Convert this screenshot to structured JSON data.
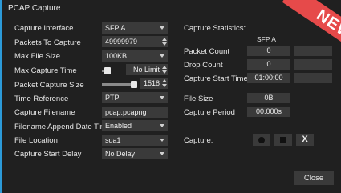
{
  "window": {
    "title": "PCAP Capture"
  },
  "settings": {
    "rows": [
      {
        "label": "Capture Interface",
        "value": "SFP A"
      },
      {
        "label": "Packets To Capture",
        "value": "49999979"
      },
      {
        "label": "Max File Size",
        "value": "100KB"
      },
      {
        "label": "Max Capture Time",
        "value": "No Limit"
      },
      {
        "label": "Packet Capture Size",
        "value": "1518"
      },
      {
        "label": "Time Reference",
        "value": "PTP"
      },
      {
        "label": "Capture Filename",
        "value": "pcap.pcapng"
      },
      {
        "label": "Filename Append Date Time",
        "value": "Enabled"
      },
      {
        "label": "File Location",
        "value": "sda1"
      },
      {
        "label": "Capture Start Delay",
        "value": "No Delay"
      }
    ]
  },
  "stats": {
    "title": "Capture Statistics:",
    "column": "SFP A",
    "packet_count_label": "Packet Count",
    "packet_count": "0",
    "drop_count_label": "Drop Count",
    "drop_count": "0",
    "start_time_label": "Capture Start Time",
    "start_time": "01:00:00",
    "file_size_label": "File Size",
    "file_size": "0B",
    "period_label": "Capture Period",
    "period": "00.000s"
  },
  "capture": {
    "label": "Capture:",
    "stop_label": "X"
  },
  "footer": {
    "close_label": "Close"
  },
  "badge": {
    "text": "NEW",
    "color": "#e64a4a"
  },
  "colors": {
    "accent": "#2c9ad8"
  }
}
